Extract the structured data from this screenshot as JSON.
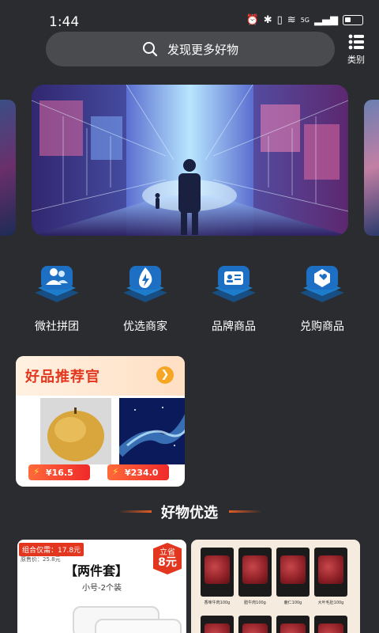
{
  "status": {
    "time": "1:44",
    "network": "5G"
  },
  "search": {
    "placeholder": "发现更多好物",
    "category_label": "类别"
  },
  "quick_nav": [
    {
      "label": "微社拼团",
      "icon": "group-icon"
    },
    {
      "label": "优选商家",
      "icon": "flame-icon"
    },
    {
      "label": "品牌商品",
      "icon": "id-card-icon"
    },
    {
      "label": "兑购商品",
      "icon": "wrench-icon"
    }
  ],
  "promo": {
    "title": "好品推荐官",
    "products": [
      {
        "price": "¥16.5"
      },
      {
        "price": "¥234.0"
      }
    ]
  },
  "section_title": "好物优选",
  "goods": [
    {
      "badge": "组合仅需：17.8元",
      "orig_price": "原售价：25.8元",
      "title": "【两件套】",
      "subtitle": "小号-2个装",
      "save_label": "立省",
      "save_amount": "8元"
    },
    {
      "labels": [
        "香味牛肉100g",
        "腊牛肉100g",
        "鹿仁100g",
        "大叶毛肚100g"
      ]
    }
  ],
  "colors": {
    "background": "#2b2c2f",
    "accent": "#e2361f",
    "search_bg": "#4a4b4f"
  }
}
